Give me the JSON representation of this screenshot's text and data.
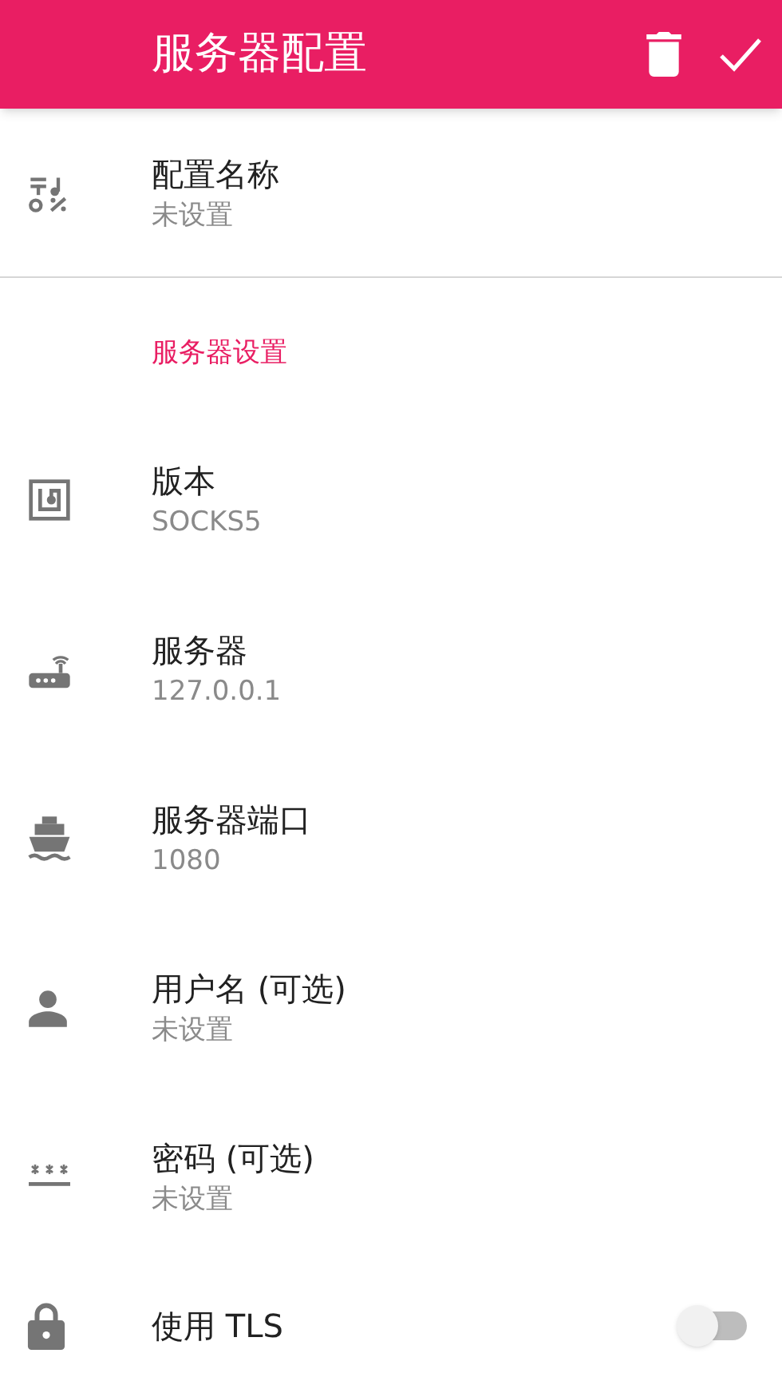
{
  "app_bar": {
    "title": "服务器配置"
  },
  "profile": {
    "title": "配置名称",
    "summary": "未设置"
  },
  "section": {
    "title": "服务器设置",
    "items": [
      {
        "kind": "preference",
        "title": "版本",
        "summary": "SOCKS5"
      },
      {
        "kind": "preference",
        "title": "服务器",
        "summary": "127.0.0.1"
      },
      {
        "kind": "preference",
        "title": "服务器端口",
        "summary": "1080"
      },
      {
        "kind": "preference",
        "title": "用户名 (可选)",
        "summary": "未设置"
      },
      {
        "kind": "preference",
        "title": "密码 (可选)",
        "summary": "未设置"
      },
      {
        "kind": "switch",
        "title": "使用 TLS",
        "checked": false
      }
    ]
  }
}
